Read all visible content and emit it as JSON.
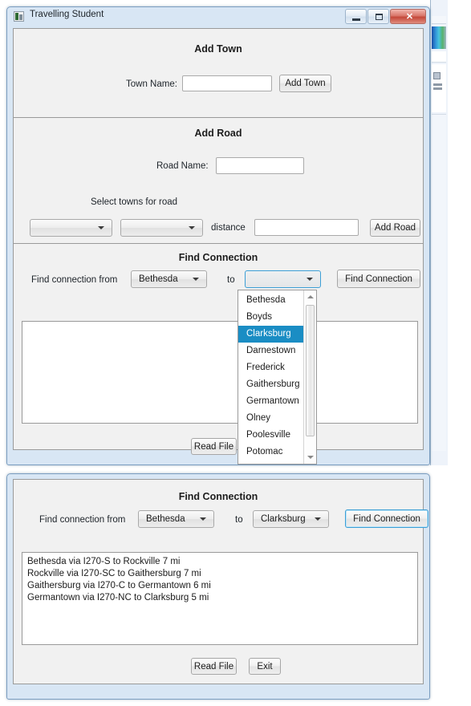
{
  "window": {
    "title": "Travelling Student",
    "icon": "app-icon",
    "controls": {
      "minimize": "–",
      "maximize": "□",
      "close": "✕"
    }
  },
  "add_town": {
    "heading": "Add Town",
    "name_label": "Town Name:",
    "name_value": "",
    "name_placeholder": "",
    "button": "Add Town"
  },
  "add_road": {
    "heading": "Add Road",
    "road_name_label": "Road Name:",
    "road_name_value": "",
    "select_towns_label": "Select towns for road",
    "town_a_value": "",
    "town_b_value": "",
    "distance_label": "distance",
    "distance_value": "",
    "button": "Add Road"
  },
  "find_connection": {
    "heading": "Find Connection",
    "from_label": "Find connection from",
    "from_value": "Bethesda",
    "to_label": "to",
    "to_value": "",
    "button": "Find Connection"
  },
  "dropdown": {
    "open": true,
    "selected": "Clarksburg",
    "highlight_color": "#1a8dc4",
    "items": [
      "Bethesda",
      "Boyds",
      "Clarksburg",
      "Darnestown",
      "Frederick",
      "Gaithersburg",
      "Germantown",
      "Olney",
      "Poolesville",
      "Potomac"
    ]
  },
  "results": {
    "lines": []
  },
  "footer": {
    "read_file": "Read File",
    "exit": "Exit"
  },
  "second_window": {
    "find_connection": {
      "heading": "Find Connection",
      "from_label": "Find connection from",
      "from_value": "Bethesda",
      "to_label": "to",
      "to_value": "Clarksburg",
      "button": "Find Connection"
    },
    "results": {
      "lines": [
        "Bethesda via I270-S to Rockville 7 mi",
        "Rockville via I270-SC to Gaithersburg 7 mi",
        "Gaithersburg via I270-C to Germantown 6 mi",
        "Germantown via I270-NC to Clarksburg 5 mi"
      ]
    },
    "footer": {
      "read_file": "Read File",
      "exit": "Exit"
    }
  }
}
